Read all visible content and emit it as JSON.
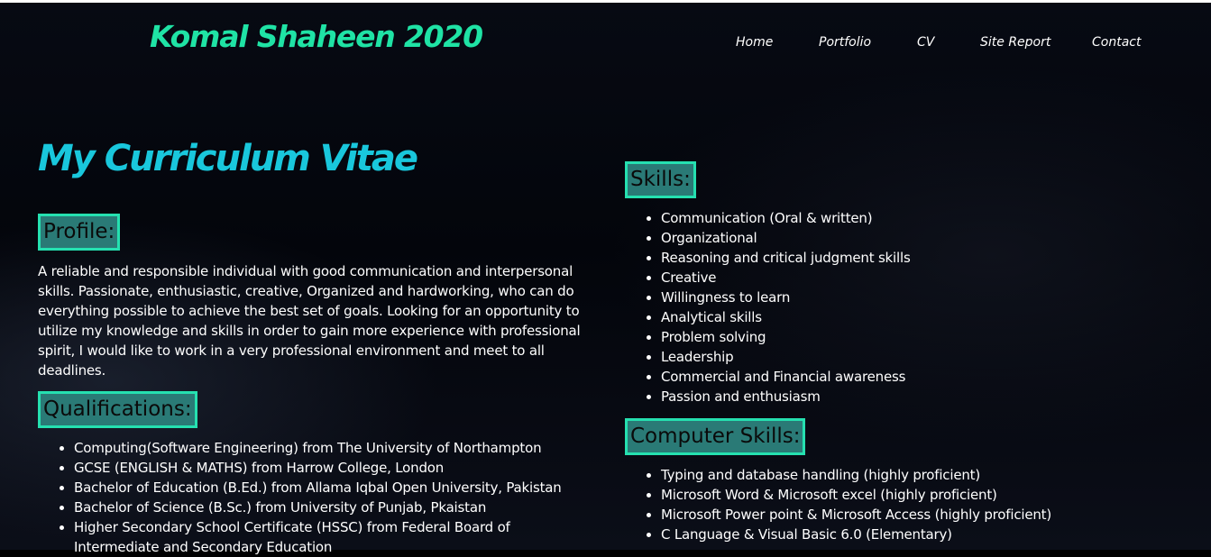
{
  "header": {
    "brand": "Komal Shaheen 2020",
    "nav": [
      "Home",
      "Portfolio",
      "CV",
      "Site Report",
      "Contact"
    ]
  },
  "main": {
    "title": "My Curriculum Vitae",
    "profile": {
      "heading": "Profile:",
      "text": "A reliable and responsible individual with good communication and interpersonal skills. Passionate, enthusiastic, creative, Organized and hardworking, who can do everything possible to achieve the best set of goals. Looking for an opportunity to utilize my knowledge and skills in order to gain more experience with professional spirit, I would like to work in a very professional environment and meet to all deadlines."
    },
    "qualifications": {
      "heading": "Qualifications:",
      "items": [
        "Computing(Software Engineering) from The University of Northampton",
        "GCSE (ENGLISH & MATHS) from Harrow College, London",
        "Bachelor of Education (B.Ed.) from Allama Iqbal Open University, Pakistan",
        "Bachelor of Science (B.Sc.) from University of Punjab, Pkaistan",
        "Higher Secondary School Certificate (HSSC) from Federal Board of Intermediate and Secondary Education"
      ]
    },
    "skills": {
      "heading": "Skills:",
      "items": [
        "Communication (Oral & written)",
        "Organizational",
        "Reasoning and critical judgment skills",
        "Creative",
        "Willingness to learn",
        "Analytical skills",
        "Problem solving",
        "Leadership",
        "Commercial and Financial awareness",
        "Passion and enthusiasm"
      ]
    },
    "computer_skills": {
      "heading": "Computer Skills:",
      "items": [
        "Typing and database handling (highly proficient)",
        "Microsoft Word & Microsoft excel (highly proficient)",
        "Microsoft Power point & Microsoft Access (highly proficient)",
        "C Language & Visual Basic 6.0 (Elementary)"
      ]
    }
  },
  "colors": {
    "brand": "#1fe3a5",
    "title": "#19c7dc",
    "heading_fill": "#2a7a76",
    "heading_border": "#25e0b0",
    "background": "#03050b"
  }
}
